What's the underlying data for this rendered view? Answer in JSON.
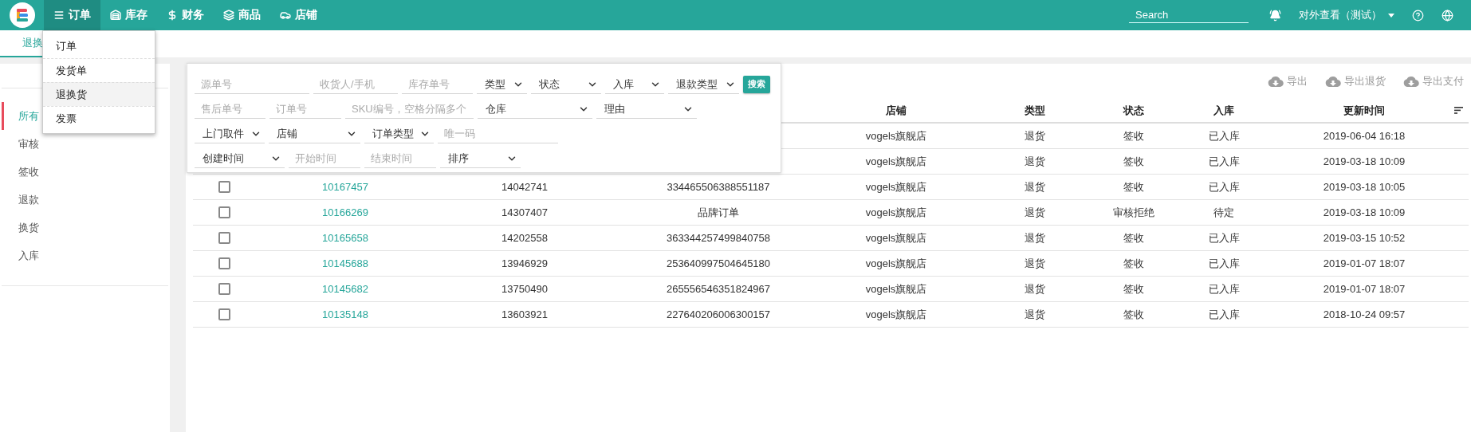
{
  "topbar": {
    "nav": [
      {
        "label": "订单",
        "selected": true
      },
      {
        "label": "库存",
        "selected": false
      },
      {
        "label": "财务",
        "selected": false
      },
      {
        "label": "商品",
        "selected": false
      },
      {
        "label": "店铺",
        "selected": false
      }
    ],
    "search": {
      "placeholder": "Search"
    },
    "user": "对外查看（测试）"
  },
  "nav_menu": [
    {
      "label": "订单",
      "selected": false
    },
    {
      "label": "发货单",
      "selected": false
    },
    {
      "label": "退换货",
      "selected": true
    },
    {
      "label": "发票",
      "selected": false
    }
  ],
  "sub_tabs": [
    {
      "label": "退换",
      "selected": true
    }
  ],
  "sidebar": {
    "items": [
      {
        "label": "所有",
        "selected": true
      },
      {
        "label": "审核",
        "selected": false
      },
      {
        "label": "签收",
        "selected": false
      },
      {
        "label": "退款",
        "selected": false
      },
      {
        "label": "换货",
        "selected": false
      },
      {
        "label": "入库",
        "selected": false
      }
    ]
  },
  "exports": [
    "导出",
    "导出退货",
    "导出支付"
  ],
  "filters": {
    "rows": [
      [
        {
          "kind": "input",
          "placeholder": "源单号"
        },
        {
          "kind": "input",
          "placeholder": "收货人/手机"
        },
        {
          "kind": "input",
          "placeholder": "库存单号"
        },
        {
          "kind": "select",
          "label": "类型"
        },
        {
          "kind": "select",
          "label": "状态"
        },
        {
          "kind": "select",
          "label": "入库"
        },
        {
          "kind": "select",
          "label": "退款类型"
        }
      ],
      [
        {
          "kind": "input",
          "placeholder": "售后单号"
        },
        {
          "kind": "input",
          "placeholder": "订单号"
        },
        {
          "kind": "input",
          "placeholder": "SKU编号，空格分隔多个"
        },
        {
          "kind": "select",
          "label": "仓库"
        },
        {
          "kind": "select",
          "label": "理由"
        }
      ],
      [
        {
          "kind": "select",
          "label": "上门取件"
        },
        {
          "kind": "select",
          "label": "店铺"
        },
        {
          "kind": "select",
          "label": "订单类型"
        },
        {
          "kind": "input",
          "placeholder": "唯一码"
        }
      ],
      [
        {
          "kind": "select",
          "label": "创建时间"
        },
        {
          "kind": "input",
          "placeholder": "开始时间"
        },
        {
          "kind": "input",
          "placeholder": "结束时间"
        },
        {
          "kind": "select",
          "label": "排序"
        }
      ]
    ],
    "search_button": "搜索"
  },
  "table": {
    "columns": [
      "店铺",
      "类型",
      "状态",
      "入库",
      "更新时间"
    ],
    "rows": [
      {
        "cells": [
          "vogels旗舰店",
          "退货",
          "签收",
          "已入库",
          "2019-06-04 16:18"
        ]
      },
      {
        "cells": [
          "vogels旗舰店",
          "退货",
          "签收",
          "已入库",
          "2019-03-18 10:09"
        ]
      },
      {
        "checked": false,
        "cells": [
          "10167457",
          "14042741",
          "334465506388551187",
          "vogels旗舰店",
          "退货",
          "签收",
          "已入库",
          "2019-03-18 10:05"
        ]
      },
      {
        "checked": false,
        "cells": [
          "10166269",
          "14307407",
          "品牌订单",
          "vogels旗舰店",
          "退货",
          "审核拒绝",
          "待定",
          "2019-03-18 10:09"
        ]
      },
      {
        "checked": false,
        "cells": [
          "10165658",
          "14202558",
          "363344257499840758",
          "vogels旗舰店",
          "退货",
          "签收",
          "已入库",
          "2019-03-15 10:52"
        ]
      },
      {
        "checked": false,
        "cells": [
          "10145688",
          "13946929",
          "253640997504645180",
          "vogels旗舰店",
          "退货",
          "签收",
          "已入库",
          "2019-01-07 18:07"
        ]
      },
      {
        "checked": false,
        "cells": [
          "10145682",
          "13750490",
          "265556546351824967",
          "vogels旗舰店",
          "退货",
          "签收",
          "已入库",
          "2019-01-07 18:07"
        ]
      },
      {
        "checked": false,
        "cells": [
          "10135148",
          "13603921",
          "227640206006300157",
          "vogels旗舰店",
          "退货",
          "签收",
          "已入库",
          "2018-10-24 09:57"
        ]
      }
    ]
  }
}
